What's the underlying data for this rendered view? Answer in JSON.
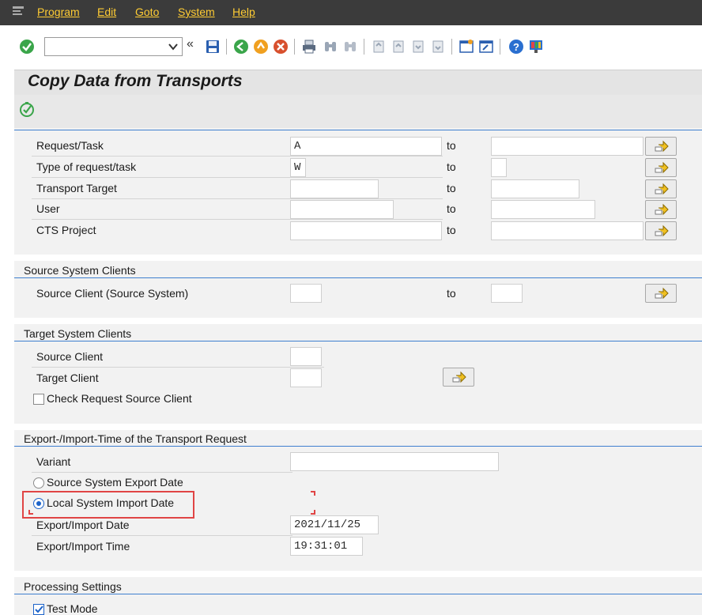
{
  "menu": {
    "items": [
      "Program",
      "Edit",
      "Goto",
      "System",
      "Help"
    ]
  },
  "toolbar": {
    "command_value": "",
    "collapse_glyph": "«"
  },
  "title": "Copy Data from Transports",
  "selection": {
    "to_label": "to",
    "rows": [
      {
        "label": "Request/Task",
        "low": "A         ",
        "high": ""
      },
      {
        "label": "Type of request/task",
        "low": "W",
        "high": ""
      },
      {
        "label": "Transport Target",
        "low": "",
        "high": ""
      },
      {
        "label": "User",
        "low": "",
        "high": ""
      },
      {
        "label": "CTS Project",
        "low": "",
        "high": ""
      }
    ]
  },
  "source_clients": {
    "title": "Source System Clients",
    "row": {
      "label": "Source Client (Source System)",
      "low": "",
      "to_label": "to",
      "high": ""
    }
  },
  "target_clients": {
    "title": "Target System Clients",
    "source_label": "Source Client",
    "source_value": "",
    "target_label": "Target Client",
    "target_value": "",
    "check_label": "Check Request Source Client"
  },
  "export_import": {
    "title": "Export-/Import-Time of the Transport Request",
    "variant_label": "Variant",
    "variant_value": "",
    "radio_source_label": "Source System Export Date",
    "radio_local_label": "Local System Import Date",
    "date_label": "Export/Import Date",
    "date_value": "2021/11/25",
    "time_label": "Export/Import Time",
    "time_value": "19:31:01"
  },
  "processing": {
    "title": "Processing Settings",
    "test_mode_label": "Test Mode",
    "test_mode_checked": true
  },
  "colors": {
    "menubar_bg": "#3b3b3b",
    "menu_text": "#ffcc33",
    "group_line": "#3f7fcf",
    "highlight": "#e04545",
    "accent_blue": "#1c63c9"
  }
}
